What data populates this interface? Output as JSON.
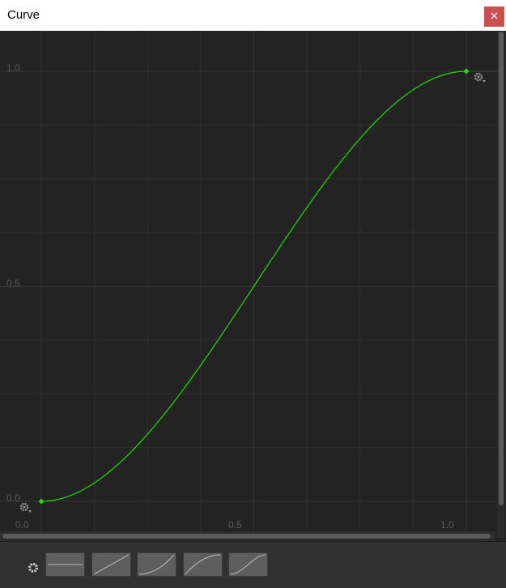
{
  "window": {
    "title": "Curve",
    "close_label": "×"
  },
  "axes": {
    "y_labels": [
      "1.0",
      "0.5",
      "0.0"
    ],
    "x_labels": [
      "0.0",
      "0.5",
      "1.0"
    ]
  },
  "curve": {
    "color": "#22dd00",
    "keys": [
      {
        "time": 0.0,
        "value": 0.0
      },
      {
        "time": 1.0,
        "value": 1.0
      }
    ],
    "shape": "ease-in-out"
  },
  "presets": [
    {
      "name": "constant"
    },
    {
      "name": "linear"
    },
    {
      "name": "ease-in"
    },
    {
      "name": "ease-out"
    },
    {
      "name": "ease-in-out"
    }
  ],
  "colors": {
    "background": "#232323",
    "grid": "#2f2f2f",
    "curve": "#22dd00"
  }
}
